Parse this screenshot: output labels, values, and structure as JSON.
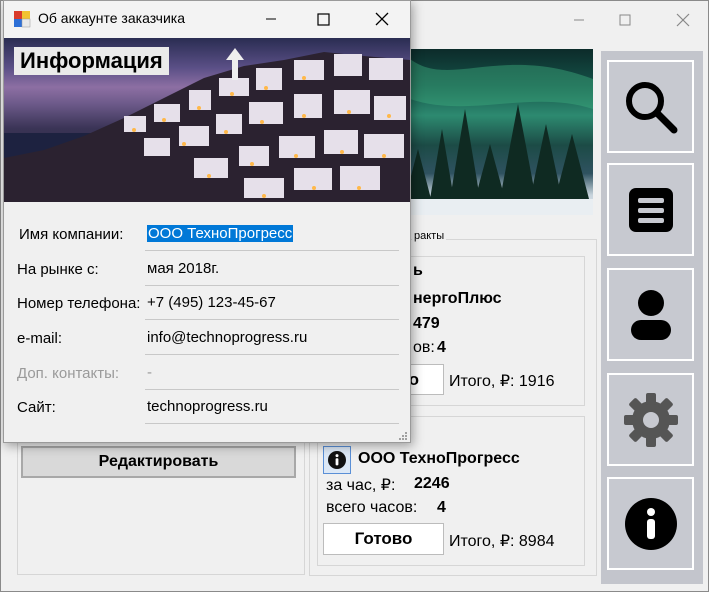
{
  "main_window": {
    "group_title": "ракты",
    "card1": {
      "line1": "ь",
      "company": "нергоПлюс",
      "rate": "479",
      "hours_label": "ов:",
      "hours": "4",
      "button": "во",
      "total": "Итого, ₽: 1916"
    },
    "card2": {
      "company": "ООО ТехноПрогресс",
      "rate_label": "за час, ₽:",
      "rate": "2246",
      "hours_label": "всего часов:",
      "hours": "4",
      "button": "Готово",
      "total": "Итого, ₽: 8984"
    },
    "edit_button": "Редактировать",
    "side_icons": [
      "search-icon",
      "list-icon",
      "user-icon",
      "gear-icon",
      "info-icon"
    ]
  },
  "dialog": {
    "title": "Об аккаунте заказчика",
    "banner": "Информация",
    "fields": [
      {
        "label": "Имя компании:",
        "value": "ООО ТехноПрогресс"
      },
      {
        "label": "На рынке с:",
        "value": "мая 2018г."
      },
      {
        "label": "Номер телефона:",
        "value": "+7 (495) 123-45-67"
      },
      {
        "label": "e-mail:",
        "value": "info@technoprogress.ru"
      },
      {
        "label": "Доп. контакты:",
        "value": "-"
      },
      {
        "label": "Сайт:",
        "value": "technoprogress.ru"
      }
    ]
  },
  "colors": {
    "sidebar": "#c3c5cc",
    "selection": "#0078d7",
    "disabled_label": "#9a9a9a"
  }
}
